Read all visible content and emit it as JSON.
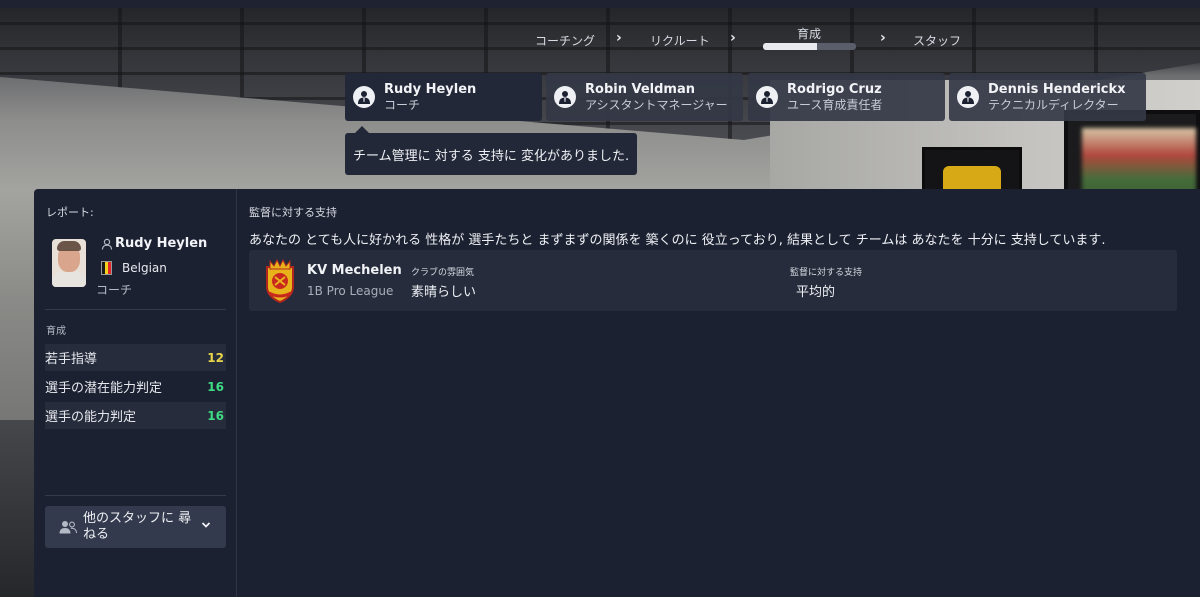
{
  "stepper": {
    "steps": [
      "コーチング",
      "リクルート",
      "育成",
      "スタッフ"
    ],
    "active_step": "育成",
    "progress": 0.58
  },
  "staff_cards": [
    {
      "name": "Rudy Heylen",
      "role": "コーチ",
      "active": true
    },
    {
      "name": "Robin Veldman",
      "role": "アシスタントマネージャー",
      "active": false
    },
    {
      "name": "Rodrigo Cruz",
      "role": "ユース育成責任者",
      "active": false
    },
    {
      "name": "Dennis Henderickx",
      "role": "テクニカルディレクター",
      "active": false
    }
  ],
  "tooltip": "チーム管理に 対する 支持に 変化がありました.",
  "sidebar": {
    "report_label": "レポート:",
    "person": {
      "name": "Rudy Heylen",
      "nationality": "Belgian",
      "role": "コーチ",
      "flag_colors": [
        "#1a1a1a",
        "#f2d21b",
        "#e2262b"
      ]
    },
    "section_title": "育成",
    "attributes": [
      {
        "label": "若手指導",
        "value": "12",
        "color": "#e9d64a"
      },
      {
        "label": "選手の潜在能力判定",
        "value": "16",
        "color": "#3ddc84"
      },
      {
        "label": "選手の能力判定",
        "value": "16",
        "color": "#3ddc84"
      }
    ],
    "ask_button": "他のスタッフに 尋ねる"
  },
  "content": {
    "title": "監督に対する支持",
    "text": "あなたの とても人に好かれる 性格が 選手たちと まずまずの関係を 築くのに 役立っており, 結果として チームは あなたを 十分に 支持しています.",
    "club": {
      "name": "KV Mechelen",
      "league": "1B Pro League",
      "atmosphere_label": "クラブの雰囲気",
      "atmosphere_value": "素晴らしい",
      "support_label": "監督に対する支持",
      "support_value": "平均的"
    }
  },
  "colors": {
    "panel_bg": "#1c2131",
    "row_bg": "#262c3c",
    "card_bg": "#343846"
  }
}
